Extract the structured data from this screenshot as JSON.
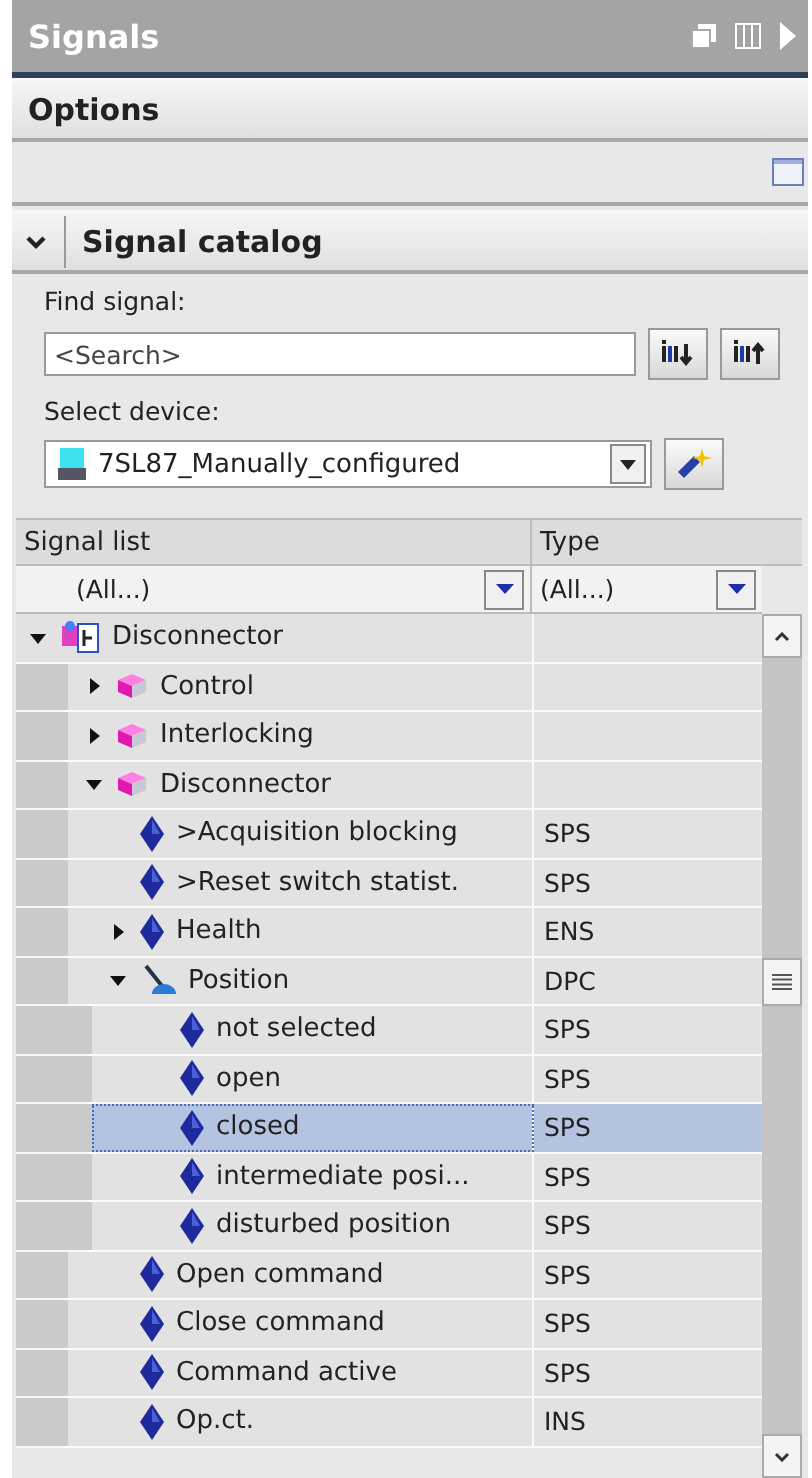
{
  "panel": {
    "title": "Signals"
  },
  "options": {
    "title": "Options"
  },
  "catalog": {
    "title": "Signal catalog",
    "expanded": true,
    "find_label": "Find signal:",
    "search_placeholder": "<Search>",
    "device_label": "Select device:",
    "device": "7SL87_Manually_configured"
  },
  "table": {
    "columns": [
      "Signal list",
      "Type"
    ],
    "filters": [
      "(All...)",
      "(All...)"
    ],
    "rows": [
      {
        "kind": "device",
        "name": "Disconnector",
        "expanded": true,
        "selected": false,
        "children": [
          {
            "kind": "folder",
            "name": "Control",
            "expanded": false,
            "selected": false
          },
          {
            "kind": "folder",
            "name": "Interlocking",
            "expanded": false,
            "selected": false
          },
          {
            "kind": "folder",
            "name": "Disconnector",
            "expanded": true,
            "selected": false,
            "children": [
              {
                "kind": "signal",
                "name": ">Acquisition blocking",
                "type": "SPS",
                "selected": false
              },
              {
                "kind": "signal",
                "name": ">Reset switch statist.",
                "type": "SPS",
                "selected": false
              },
              {
                "kind": "signal",
                "name": "Health",
                "type": "ENS",
                "expanded": false,
                "selected": false
              },
              {
                "kind": "control",
                "name": "Position",
                "type": "DPC",
                "expanded": true,
                "selected": false,
                "children": [
                  {
                    "kind": "signal",
                    "name": "not selected",
                    "type": "SPS",
                    "selected": false
                  },
                  {
                    "kind": "signal",
                    "name": "open",
                    "type": "SPS",
                    "selected": false
                  },
                  {
                    "kind": "signal",
                    "name": "closed",
                    "type": "SPS",
                    "selected": true
                  },
                  {
                    "kind": "signal",
                    "name": "intermediate posi...",
                    "type": "SPS",
                    "selected": false
                  },
                  {
                    "kind": "signal",
                    "name": "disturbed position",
                    "type": "SPS",
                    "selected": false
                  }
                ]
              },
              {
                "kind": "signal",
                "name": "Open command",
                "type": "SPS",
                "selected": false
              },
              {
                "kind": "signal",
                "name": "Close command",
                "type": "SPS",
                "selected": false
              },
              {
                "kind": "signal",
                "name": "Command active",
                "type": "SPS",
                "selected": false
              },
              {
                "kind": "signal",
                "name": "Op.ct.",
                "type": "INS",
                "selected": false
              }
            ]
          }
        ]
      }
    ]
  }
}
